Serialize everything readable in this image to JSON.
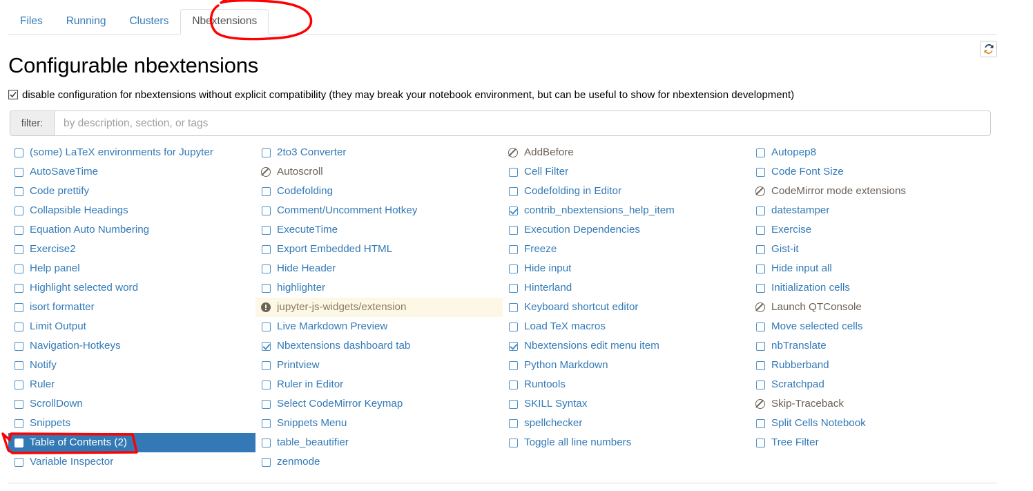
{
  "nav": {
    "tabs": [
      {
        "label": "Files",
        "active": false
      },
      {
        "label": "Running",
        "active": false
      },
      {
        "label": "Clusters",
        "active": false
      },
      {
        "label": "Nbextensions",
        "active": true
      }
    ]
  },
  "toolbar": {
    "refresh_icon": "refresh-icon",
    "refresh_title": "Refresh"
  },
  "header": {
    "title": "Configurable nbextensions"
  },
  "options": {
    "disable_config": {
      "label": "disable configuration for nbextensions without explicit compatibility (they may break your notebook environment, but can be useful to show for nbextension development)",
      "checked": true
    }
  },
  "filter": {
    "addon_label": "filter:",
    "placeholder": "by description, section, or tags",
    "value": ""
  },
  "colors": {
    "link": "#337ab7",
    "selected_bg": "#3379b6",
    "warning_bg": "#fdf8e6",
    "incompatible_text": "#6b6259",
    "annotation": "#ff0000"
  },
  "extensions": {
    "columns": [
      {
        "items": [
          {
            "label": "(some) LaTeX environments for Jupyter",
            "state": "unchecked",
            "icon": "checkbox-unchecked-icon"
          },
          {
            "label": "AutoSaveTime",
            "state": "unchecked",
            "icon": "checkbox-unchecked-icon"
          },
          {
            "label": "Code prettify",
            "state": "unchecked",
            "icon": "checkbox-unchecked-icon"
          },
          {
            "label": "Collapsible Headings",
            "state": "unchecked",
            "icon": "checkbox-unchecked-icon"
          },
          {
            "label": "Equation Auto Numbering",
            "state": "unchecked",
            "icon": "checkbox-unchecked-icon"
          },
          {
            "label": "Exercise2",
            "state": "unchecked",
            "icon": "checkbox-unchecked-icon"
          },
          {
            "label": "Help panel",
            "state": "unchecked",
            "icon": "checkbox-unchecked-icon"
          },
          {
            "label": "Highlight selected word",
            "state": "unchecked",
            "icon": "checkbox-unchecked-icon"
          },
          {
            "label": "isort formatter",
            "state": "unchecked",
            "icon": "checkbox-unchecked-icon"
          },
          {
            "label": "Limit Output",
            "state": "unchecked",
            "icon": "checkbox-unchecked-icon"
          },
          {
            "label": "Navigation-Hotkeys",
            "state": "unchecked",
            "icon": "checkbox-unchecked-icon"
          },
          {
            "label": "Notify",
            "state": "unchecked",
            "icon": "checkbox-unchecked-icon"
          },
          {
            "label": "Ruler",
            "state": "unchecked",
            "icon": "checkbox-unchecked-icon"
          },
          {
            "label": "ScrollDown",
            "state": "unchecked",
            "icon": "checkbox-unchecked-icon"
          },
          {
            "label": "Snippets",
            "state": "unchecked",
            "icon": "checkbox-unchecked-icon"
          },
          {
            "label": "Table of Contents (2)",
            "state": "checked-selected",
            "icon": "checkbox-checked-icon"
          },
          {
            "label": "Variable Inspector",
            "state": "unchecked",
            "icon": "checkbox-unchecked-icon"
          }
        ]
      },
      {
        "items": [
          {
            "label": "2to3 Converter",
            "state": "unchecked",
            "icon": "checkbox-unchecked-icon"
          },
          {
            "label": "Autoscroll",
            "state": "incompatible",
            "icon": "blocked-icon"
          },
          {
            "label": "Codefolding",
            "state": "unchecked",
            "icon": "checkbox-unchecked-icon"
          },
          {
            "label": "Comment/Uncomment Hotkey",
            "state": "unchecked",
            "icon": "checkbox-unchecked-icon"
          },
          {
            "label": "ExecuteTime",
            "state": "unchecked",
            "icon": "checkbox-unchecked-icon"
          },
          {
            "label": "Export Embedded HTML",
            "state": "unchecked",
            "icon": "checkbox-unchecked-icon"
          },
          {
            "label": "Hide Header",
            "state": "unchecked",
            "icon": "checkbox-unchecked-icon"
          },
          {
            "label": "highlighter",
            "state": "unchecked",
            "icon": "checkbox-unchecked-icon"
          },
          {
            "label": "jupyter-js-widgets/extension",
            "state": "warning",
            "icon": "warning-icon"
          },
          {
            "label": "Live Markdown Preview",
            "state": "unchecked",
            "icon": "checkbox-unchecked-icon"
          },
          {
            "label": "Nbextensions dashboard tab",
            "state": "checked",
            "icon": "checkbox-checked-icon"
          },
          {
            "label": "Printview",
            "state": "unchecked",
            "icon": "checkbox-unchecked-icon"
          },
          {
            "label": "Ruler in Editor",
            "state": "unchecked",
            "icon": "checkbox-unchecked-icon"
          },
          {
            "label": "Select CodeMirror Keymap",
            "state": "unchecked",
            "icon": "checkbox-unchecked-icon"
          },
          {
            "label": "Snippets Menu",
            "state": "unchecked",
            "icon": "checkbox-unchecked-icon"
          },
          {
            "label": "table_beautifier",
            "state": "unchecked",
            "icon": "checkbox-unchecked-icon"
          },
          {
            "label": "zenmode",
            "state": "unchecked",
            "icon": "checkbox-unchecked-icon"
          }
        ]
      },
      {
        "items": [
          {
            "label": "AddBefore",
            "state": "incompatible",
            "icon": "blocked-icon"
          },
          {
            "label": "Cell Filter",
            "state": "unchecked",
            "icon": "checkbox-unchecked-icon"
          },
          {
            "label": "Codefolding in Editor",
            "state": "unchecked",
            "icon": "checkbox-unchecked-icon"
          },
          {
            "label": "contrib_nbextensions_help_item",
            "state": "checked",
            "icon": "checkbox-checked-icon"
          },
          {
            "label": "Execution Dependencies",
            "state": "unchecked",
            "icon": "checkbox-unchecked-icon"
          },
          {
            "label": "Freeze",
            "state": "unchecked",
            "icon": "checkbox-unchecked-icon"
          },
          {
            "label": "Hide input",
            "state": "unchecked",
            "icon": "checkbox-unchecked-icon"
          },
          {
            "label": "Hinterland",
            "state": "unchecked",
            "icon": "checkbox-unchecked-icon"
          },
          {
            "label": "Keyboard shortcut editor",
            "state": "unchecked",
            "icon": "checkbox-unchecked-icon"
          },
          {
            "label": "Load TeX macros",
            "state": "unchecked",
            "icon": "checkbox-unchecked-icon"
          },
          {
            "label": "Nbextensions edit menu item",
            "state": "checked",
            "icon": "checkbox-checked-icon"
          },
          {
            "label": "Python Markdown",
            "state": "unchecked",
            "icon": "checkbox-unchecked-icon"
          },
          {
            "label": "Runtools",
            "state": "unchecked",
            "icon": "checkbox-unchecked-icon"
          },
          {
            "label": "SKILL Syntax",
            "state": "unchecked",
            "icon": "checkbox-unchecked-icon"
          },
          {
            "label": "spellchecker",
            "state": "unchecked",
            "icon": "checkbox-unchecked-icon"
          },
          {
            "label": "Toggle all line numbers",
            "state": "unchecked",
            "icon": "checkbox-unchecked-icon"
          }
        ]
      },
      {
        "items": [
          {
            "label": "Autopep8",
            "state": "unchecked",
            "icon": "checkbox-unchecked-icon"
          },
          {
            "label": "Code Font Size",
            "state": "unchecked",
            "icon": "checkbox-unchecked-icon"
          },
          {
            "label": "CodeMirror mode extensions",
            "state": "incompatible",
            "icon": "blocked-icon"
          },
          {
            "label": "datestamper",
            "state": "unchecked",
            "icon": "checkbox-unchecked-icon"
          },
          {
            "label": "Exercise",
            "state": "unchecked",
            "icon": "checkbox-unchecked-icon"
          },
          {
            "label": "Gist-it",
            "state": "unchecked",
            "icon": "checkbox-unchecked-icon"
          },
          {
            "label": "Hide input all",
            "state": "unchecked",
            "icon": "checkbox-unchecked-icon"
          },
          {
            "label": "Initialization cells",
            "state": "unchecked",
            "icon": "checkbox-unchecked-icon"
          },
          {
            "label": "Launch QTConsole",
            "state": "incompatible",
            "icon": "blocked-icon"
          },
          {
            "label": "Move selected cells",
            "state": "unchecked",
            "icon": "checkbox-unchecked-icon"
          },
          {
            "label": "nbTranslate",
            "state": "unchecked",
            "icon": "checkbox-unchecked-icon"
          },
          {
            "label": "Rubberband",
            "state": "unchecked",
            "icon": "checkbox-unchecked-icon"
          },
          {
            "label": "Scratchpad",
            "state": "unchecked",
            "icon": "checkbox-unchecked-icon"
          },
          {
            "label": "Skip-Traceback",
            "state": "incompatible",
            "icon": "blocked-icon"
          },
          {
            "label": "Split Cells Notebook",
            "state": "unchecked",
            "icon": "checkbox-unchecked-icon"
          },
          {
            "label": "Tree Filter",
            "state": "unchecked",
            "icon": "checkbox-unchecked-icon"
          }
        ]
      }
    ]
  },
  "annotations": [
    {
      "name": "annotation-circle-nbextensions-tab",
      "shape": "hand-drawn-ellipse"
    },
    {
      "name": "annotation-rect-table-of-contents",
      "shape": "hand-drawn-rectangle"
    }
  ]
}
